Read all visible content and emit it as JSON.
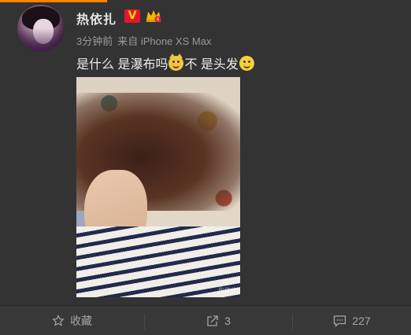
{
  "post": {
    "username": "热依扎",
    "verified_badge": "V",
    "time": "3分钟前",
    "source": "来自 iPhone XS Max",
    "text_parts": [
      "是什么 是瀑布吗",
      "不 是头发"
    ],
    "emojis": [
      "cat-face-emoji",
      "smile-emoji"
    ],
    "photo_watermark": "热依扎"
  },
  "actions": {
    "favorite_label": "收藏",
    "share_count": "3",
    "comment_count": "227"
  },
  "colors": {
    "background": "#333333",
    "accent": "#ff8200",
    "verified_red": "#e6162d",
    "verified_yellow": "#ffd400"
  }
}
